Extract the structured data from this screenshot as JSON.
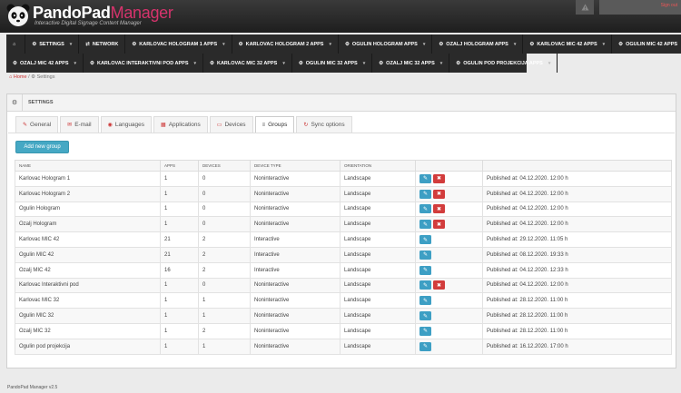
{
  "header": {
    "brand_main": "PandoPad",
    "brand_accent": "Manager",
    "tagline": "Interactive Digital Signage Content Manager",
    "signout": "Sign out"
  },
  "nav": {
    "row1": [
      {
        "label": "",
        "icon": "home-icon",
        "caret": false
      },
      {
        "label": "SETTINGS",
        "icon": "gear-icon",
        "caret": true
      },
      {
        "label": "NETWORK",
        "icon": "network-icon",
        "caret": false
      },
      {
        "label": "KARLOVAC HOLOGRAM 1 APPS",
        "icon": "apps-icon",
        "caret": true
      },
      {
        "label": "KARLOVAC HOLOGRAM 2 APPS",
        "icon": "apps-icon",
        "caret": true
      },
      {
        "label": "OGULIN HOLOGRAM APPS",
        "icon": "apps-icon",
        "caret": true
      },
      {
        "label": "OZALJ HOLOGRAM APPS",
        "icon": "apps-icon",
        "caret": true
      },
      {
        "label": "KARLOVAC MIC 42 APPS",
        "icon": "apps-icon",
        "caret": true
      },
      {
        "label": "OGULIN MIC 42 APPS",
        "icon": "apps-icon",
        "caret": true
      }
    ],
    "row2": [
      {
        "label": "OZALJ MIC 42 APPS",
        "icon": "apps-icon",
        "caret": true
      },
      {
        "label": "KARLOVAC INTERAKTIVNI POD APPS",
        "icon": "apps-icon",
        "caret": true
      },
      {
        "label": "KARLOVAC MIC 32 APPS",
        "icon": "apps-icon",
        "caret": true
      },
      {
        "label": "OGULIN MIC 32 APPS",
        "icon": "apps-icon",
        "caret": true
      },
      {
        "label": "OZALJ MIC 32 APPS",
        "icon": "apps-icon",
        "caret": true
      },
      {
        "label": "OGULIN POD PROJEKCIJA APPS",
        "icon": "apps-icon",
        "caret": true
      }
    ]
  },
  "breadcrumb": {
    "home": "Home",
    "separator": "/",
    "current": "Settings"
  },
  "panel": {
    "title": "SETTINGS"
  },
  "tabs": [
    {
      "label": "General",
      "icon": "wrench-icon",
      "active": false
    },
    {
      "label": "E-mail",
      "icon": "envelope-icon",
      "active": false
    },
    {
      "label": "Languages",
      "icon": "globe-icon",
      "active": false
    },
    {
      "label": "Applications",
      "icon": "grid-icon",
      "active": false
    },
    {
      "label": "Devices",
      "icon": "monitor-icon",
      "active": false
    },
    {
      "label": "Groups",
      "icon": "list-icon",
      "active": true
    },
    {
      "label": "Sync options",
      "icon": "sync-icon",
      "active": false
    }
  ],
  "add_button": "Add new group",
  "table": {
    "headers": [
      "NAME",
      "APPS",
      "DEVICES",
      "DEVICE TYPE",
      "ORIENTATION",
      "",
      ""
    ],
    "rows": [
      {
        "name": "Karlovac Hologram 1",
        "apps": "1",
        "devices": "0",
        "type": "Noninteractive",
        "orientation": "Landscape",
        "deletable": true,
        "published": "Published at: 04.12.2020. 12:00 h"
      },
      {
        "name": "Karlovac Hologram 2",
        "apps": "1",
        "devices": "0",
        "type": "Noninteractive",
        "orientation": "Landscape",
        "deletable": true,
        "published": "Published at: 04.12.2020. 12:00 h"
      },
      {
        "name": "Ogulin Hologram",
        "apps": "1",
        "devices": "0",
        "type": "Noninteractive",
        "orientation": "Landscape",
        "deletable": true,
        "published": "Published at: 04.12.2020. 12:00 h"
      },
      {
        "name": "Ozalj Hologram",
        "apps": "1",
        "devices": "0",
        "type": "Noninteractive",
        "orientation": "Landscape",
        "deletable": true,
        "published": "Published at: 04.12.2020. 12:00 h"
      },
      {
        "name": "Karlovac MIC 42",
        "apps": "21",
        "devices": "2",
        "type": "Interactive",
        "orientation": "Landscape",
        "deletable": false,
        "published": "Published at: 29.12.2020. 11:05 h"
      },
      {
        "name": "Ogulin MIC 42",
        "apps": "21",
        "devices": "2",
        "type": "Interactive",
        "orientation": "Landscape",
        "deletable": false,
        "published": "Published at: 08.12.2020. 19:33 h"
      },
      {
        "name": "Ozalj MIC 42",
        "apps": "16",
        "devices": "2",
        "type": "Interactive",
        "orientation": "Landscape",
        "deletable": false,
        "published": "Published at: 04.12.2020. 12:33 h"
      },
      {
        "name": "Karlovac Interaktivni pod",
        "apps": "1",
        "devices": "0",
        "type": "Noninteractive",
        "orientation": "Landscape",
        "deletable": true,
        "published": "Published at: 04.12.2020. 12:00 h"
      },
      {
        "name": "Karlovac MIC 32",
        "apps": "1",
        "devices": "1",
        "type": "Noninteractive",
        "orientation": "Landscape",
        "deletable": false,
        "published": "Published at: 28.12.2020. 11:00 h"
      },
      {
        "name": "Ogulin MIC 32",
        "apps": "1",
        "devices": "1",
        "type": "Noninteractive",
        "orientation": "Landscape",
        "deletable": false,
        "published": "Published at: 28.12.2020. 11:00 h"
      },
      {
        "name": "Ozalj MIC 32",
        "apps": "1",
        "devices": "2",
        "type": "Noninteractive",
        "orientation": "Landscape",
        "deletable": false,
        "published": "Published at: 28.12.2020. 11:00 h"
      },
      {
        "name": "Ogulin pod projekcija",
        "apps": "1",
        "devices": "1",
        "type": "Noninteractive",
        "orientation": "Landscape",
        "deletable": false,
        "published": "Published at: 16.12.2020. 17:00 h"
      }
    ]
  },
  "footer": "PandoPad Manager v2.5",
  "colors": {
    "accent": "#d6336c",
    "edit": "#3d9fc4",
    "delete": "#d23c3c",
    "add_button": "#45a8c4"
  }
}
